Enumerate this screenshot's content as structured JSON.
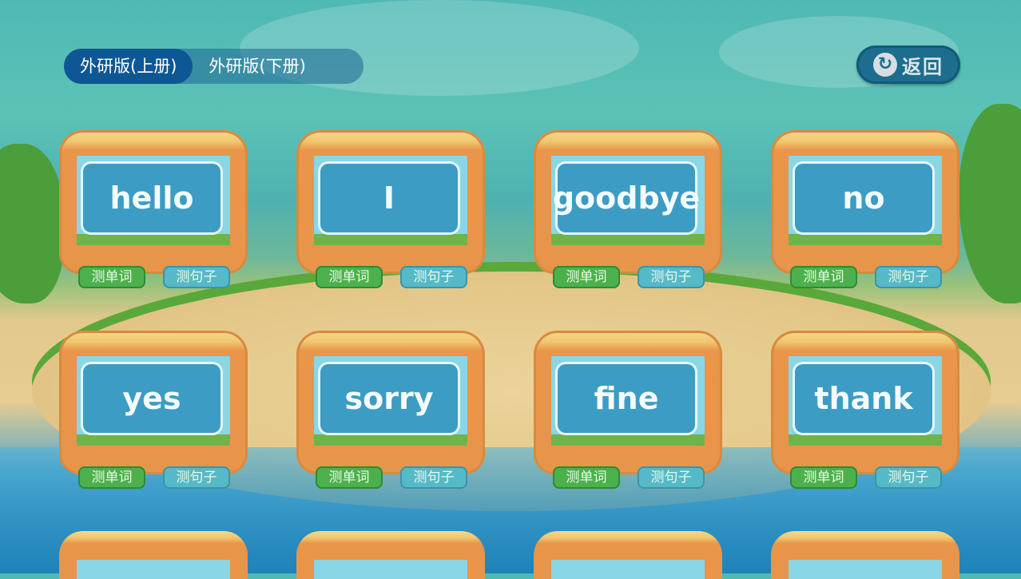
{
  "tabs": [
    {
      "label": "外研版(上册)",
      "active": true
    },
    {
      "label": "外研版(下册)",
      "active": false
    }
  ],
  "back_button": {
    "icon": "refresh-arrow-icon",
    "label": "返回"
  },
  "cards": [
    {
      "word": "hello",
      "test_word_label": "测单词",
      "test_sentence_label": "测句子"
    },
    {
      "word": "I",
      "test_word_label": "测单词",
      "test_sentence_label": "测句子"
    },
    {
      "word": "goodbye",
      "test_word_label": "测单词",
      "test_sentence_label": "测句子"
    },
    {
      "word": "no",
      "test_word_label": "测单词",
      "test_sentence_label": "测句子"
    },
    {
      "word": "yes",
      "test_word_label": "测单词",
      "test_sentence_label": "测句子"
    },
    {
      "word": "sorry",
      "test_word_label": "测单词",
      "test_sentence_label": "测句子"
    },
    {
      "word": "fine",
      "test_word_label": "测单词",
      "test_sentence_label": "测句子"
    },
    {
      "word": "thank",
      "test_word_label": "测单词",
      "test_sentence_label": "测句子"
    }
  ],
  "colors": {
    "tab_active": "#0e5795",
    "word_button": "#4cb14c",
    "sentence_button": "#56b9c8",
    "card_word_bg": "#3c9cc4"
  }
}
